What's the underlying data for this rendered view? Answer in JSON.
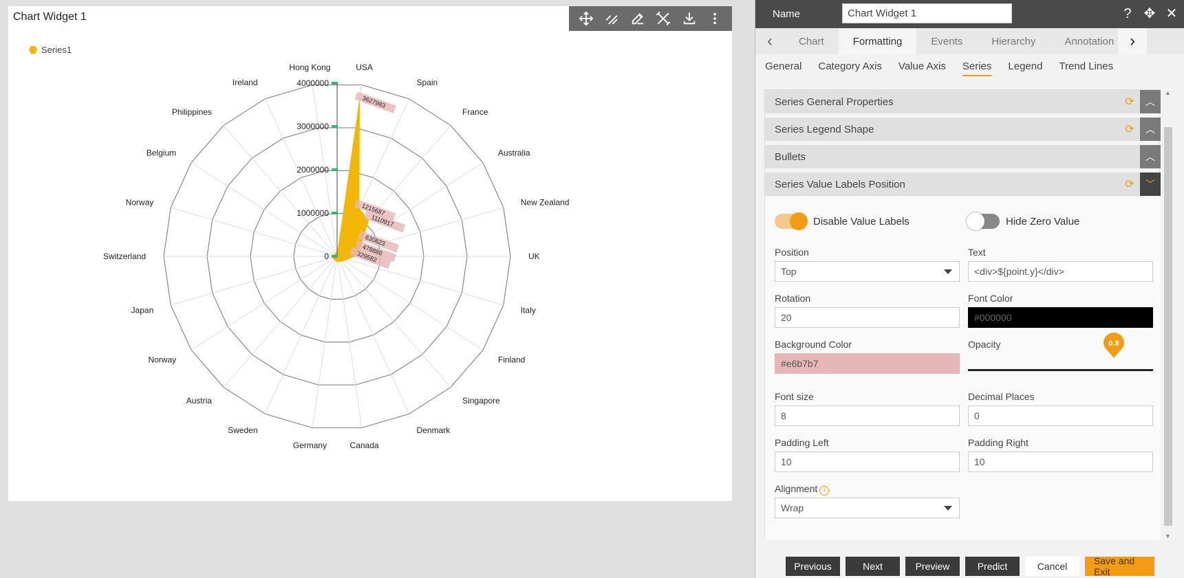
{
  "widget": {
    "title": "Chart Widget 1",
    "toolbar_icons": [
      "move-icon",
      "link-icon",
      "edit-icon",
      "tools-icon",
      "download-icon",
      "more-icon"
    ]
  },
  "chart_data": {
    "type": "radar",
    "categories": [
      "USA",
      "Spain",
      "France",
      "Australia",
      "New Zealand",
      "UK",
      "Italy",
      "Finland",
      "Singapore",
      "Denmark",
      "Canada",
      "Germany",
      "Sweden",
      "Austria",
      "Norway",
      "Japan",
      "Switzerland",
      "Norway",
      "Belgium",
      "Philippines",
      "Ireland",
      "Hong Kong"
    ],
    "series": [
      {
        "name": "Series1",
        "color": "#f2b705",
        "values": [
          3627983,
          1215687,
          1110917,
          630623,
          478880,
          329582,
          180000,
          120000,
          90000,
          70000,
          60000,
          50000,
          40000,
          35000,
          30000,
          25000,
          20000,
          18000,
          15000,
          12000,
          10000,
          8000
        ]
      }
    ],
    "value_axis_ticks": [
      "0",
      "1000000",
      "2000000",
      "3000000",
      "4000000"
    ],
    "ylim": [
      0,
      4000000
    ],
    "data_labels": [
      "3627983",
      "1215687",
      "1110917",
      "630623",
      "478880",
      "329582"
    ],
    "label_background": "#e6b7b7",
    "grid": true,
    "legend": "top-left"
  },
  "panel": {
    "name_label": "Name",
    "name_value": "Chart Widget 1",
    "tabs": [
      "Chart",
      "Formatting",
      "Events",
      "Hierarchy",
      "Annotation"
    ],
    "active_tab": "Formatting",
    "subtabs": [
      "General",
      "Category Axis",
      "Value Axis",
      "Series",
      "Legend",
      "Trend Lines"
    ],
    "active_subtab": "Series",
    "sections": [
      {
        "label": "Series General Properties"
      },
      {
        "label": "Series Legend Shape"
      },
      {
        "label": "Bullets"
      },
      {
        "label": "Series Value Labels Position"
      }
    ],
    "form": {
      "disable_value_labels": "Disable Value Labels",
      "hide_zero_value": "Hide Zero Value",
      "position_label": "Position",
      "position_value": "Top",
      "text_label": "Text",
      "text_value": "<div>${point.y}</div>",
      "rotation_label": "Rotation",
      "rotation_value": "20",
      "font_color_label": "Font Color",
      "font_color_value": "#000000",
      "bg_color_label": "Background Color",
      "bg_color_value": "#e6b7b7",
      "opacity_label": "Opacity",
      "opacity_value": "0.8",
      "font_size_label": "Font size",
      "font_size_value": "8",
      "decimal_label": "Decimal Places",
      "decimal_value": "0",
      "padding_left_label": "Padding Left",
      "padding_left_value": "10",
      "padding_right_label": "Padding Right",
      "padding_right_value": "10",
      "alignment_label": "Alignment",
      "alignment_value": "Wrap"
    },
    "buttons": {
      "previous": "Previous",
      "next": "Next",
      "preview": "Preview",
      "predict": "Predict",
      "cancel": "Cancel",
      "save_exit": "Save and Exit"
    }
  }
}
